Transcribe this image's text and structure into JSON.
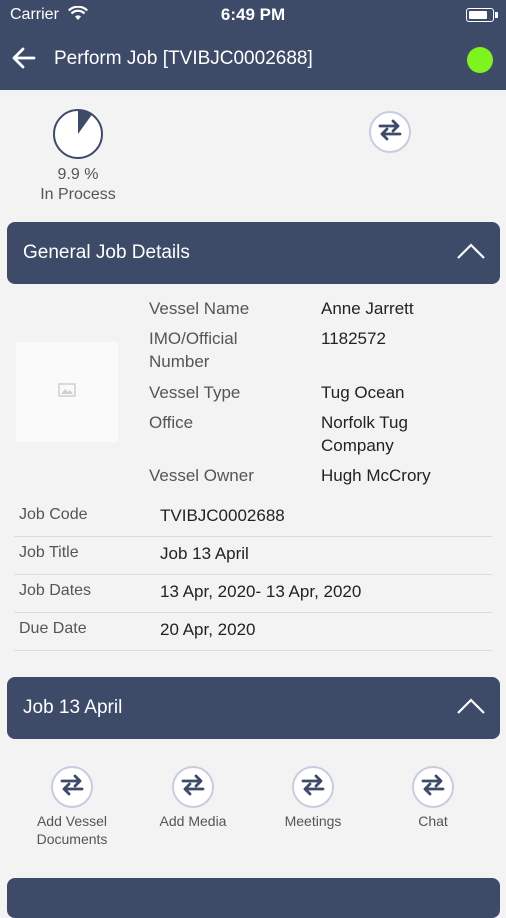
{
  "status_bar": {
    "carrier": "Carrier",
    "time": "6:49 PM"
  },
  "nav": {
    "title": "Perform Job [TVIBJC0002688]",
    "online_color": "#7ef41e"
  },
  "progress": {
    "percent_text": "9.9 %",
    "fraction": 0.099,
    "status": "In Process"
  },
  "general": {
    "header": "General Job Details",
    "vessel": [
      {
        "label": "Vessel Name",
        "value": "Anne Jarrett"
      },
      {
        "label": "IMO/Official Number",
        "value": "1182572"
      },
      {
        "label": "Vessel Type",
        "value": "Tug Ocean"
      },
      {
        "label": "Office",
        "value": "Norfolk Tug Company"
      },
      {
        "label": "Vessel Owner",
        "value": "Hugh McCrory"
      }
    ],
    "rows": [
      {
        "label": "Job Code",
        "value": "TVIBJC0002688"
      },
      {
        "label": "Job Title",
        "value": "Job 13 April"
      },
      {
        "label": "Job Dates",
        "value": "13 Apr, 2020- 13 Apr, 2020"
      },
      {
        "label": "Due Date",
        "value": "20 Apr, 2020"
      }
    ]
  },
  "job_section": {
    "header": "Job 13 April",
    "actions": [
      {
        "label": "Add Vessel Documents"
      },
      {
        "label": "Add Media"
      },
      {
        "label": "Meetings"
      },
      {
        "label": "Chat"
      }
    ]
  },
  "colors": {
    "header_bg": "#3d4a68",
    "accent": "#3d4a68",
    "background": "#f3f3f4"
  }
}
